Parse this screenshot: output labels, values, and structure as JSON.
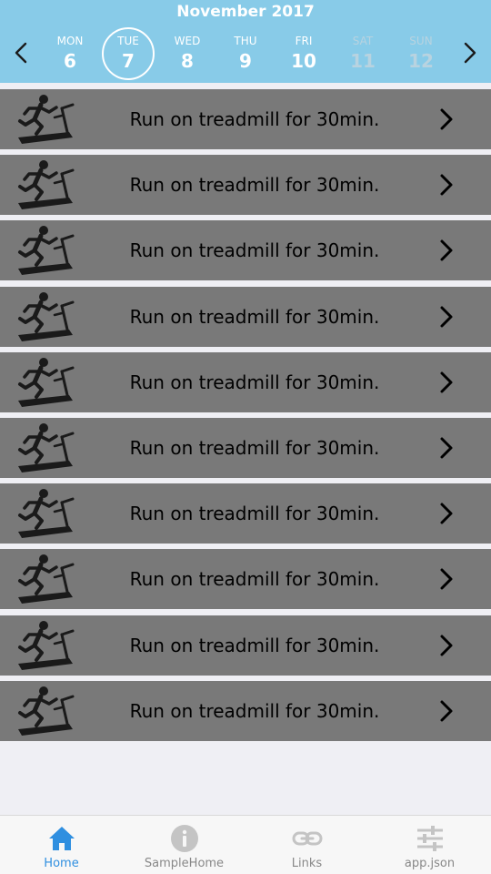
{
  "header": {
    "month_title": "November 2017",
    "days": [
      {
        "name": "MON",
        "num": "6"
      },
      {
        "name": "TUE",
        "num": "7",
        "selected": true
      },
      {
        "name": "WED",
        "num": "8"
      },
      {
        "name": "THU",
        "num": "9"
      },
      {
        "name": "FRI",
        "num": "10"
      },
      {
        "name": "SAT",
        "num": "11",
        "weekend": true
      },
      {
        "name": "SUN",
        "num": "12",
        "weekend": true
      }
    ],
    "prev_icon": "chevron-left-icon",
    "next_icon": "chevron-right-icon",
    "background_color": "#88cbe8"
  },
  "workouts": [
    {
      "label": "Run on treadmill for 30min.",
      "icon": "treadmill-icon"
    },
    {
      "label": "Run on treadmill for 30min.",
      "icon": "treadmill-icon"
    },
    {
      "label": "Run on treadmill for 30min.",
      "icon": "treadmill-icon"
    },
    {
      "label": "Run on treadmill for 30min.",
      "icon": "treadmill-icon"
    },
    {
      "label": "Run on treadmill for 30min.",
      "icon": "treadmill-icon"
    },
    {
      "label": "Run on treadmill for 30min.",
      "icon": "treadmill-icon"
    },
    {
      "label": "Run on treadmill for 30min.",
      "icon": "treadmill-icon"
    },
    {
      "label": "Run on treadmill for 30min.",
      "icon": "treadmill-icon"
    },
    {
      "label": "Run on treadmill for 30min.",
      "icon": "treadmill-icon"
    },
    {
      "label": "Run on treadmill for 30min.",
      "icon": "treadmill-icon"
    }
  ],
  "tabbar": {
    "tabs": [
      {
        "label": "Home",
        "icon": "home-icon",
        "active": true
      },
      {
        "label": "SampleHome",
        "icon": "info-icon"
      },
      {
        "label": "Links",
        "icon": "link-icon"
      },
      {
        "label": "app.json",
        "icon": "sliders-icon"
      }
    ],
    "active_color": "#2f8fe0",
    "inactive_color": "#888888"
  }
}
